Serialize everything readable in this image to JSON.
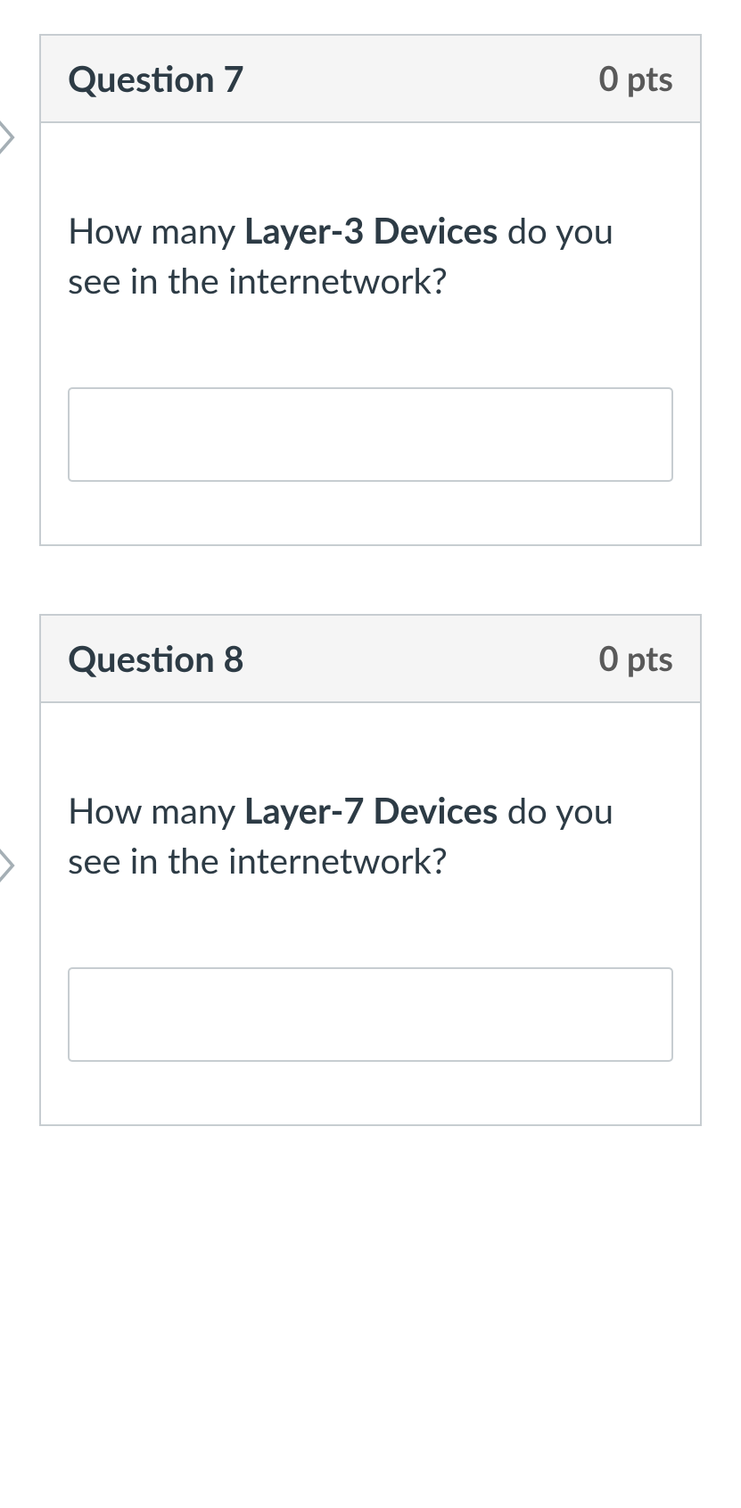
{
  "questions": [
    {
      "title": "Question 7",
      "points": "0 pts",
      "prompt_prefix": "How many ",
      "prompt_bold": "Layer-3 Devices",
      "prompt_suffix": " do you see in the internetwork?",
      "answer_value": ""
    },
    {
      "title": "Question 8",
      "points": "0 pts",
      "prompt_prefix": "How many ",
      "prompt_bold": "Layer-7 Devices",
      "prompt_suffix": " do you see in the internetwork?",
      "answer_value": ""
    }
  ]
}
